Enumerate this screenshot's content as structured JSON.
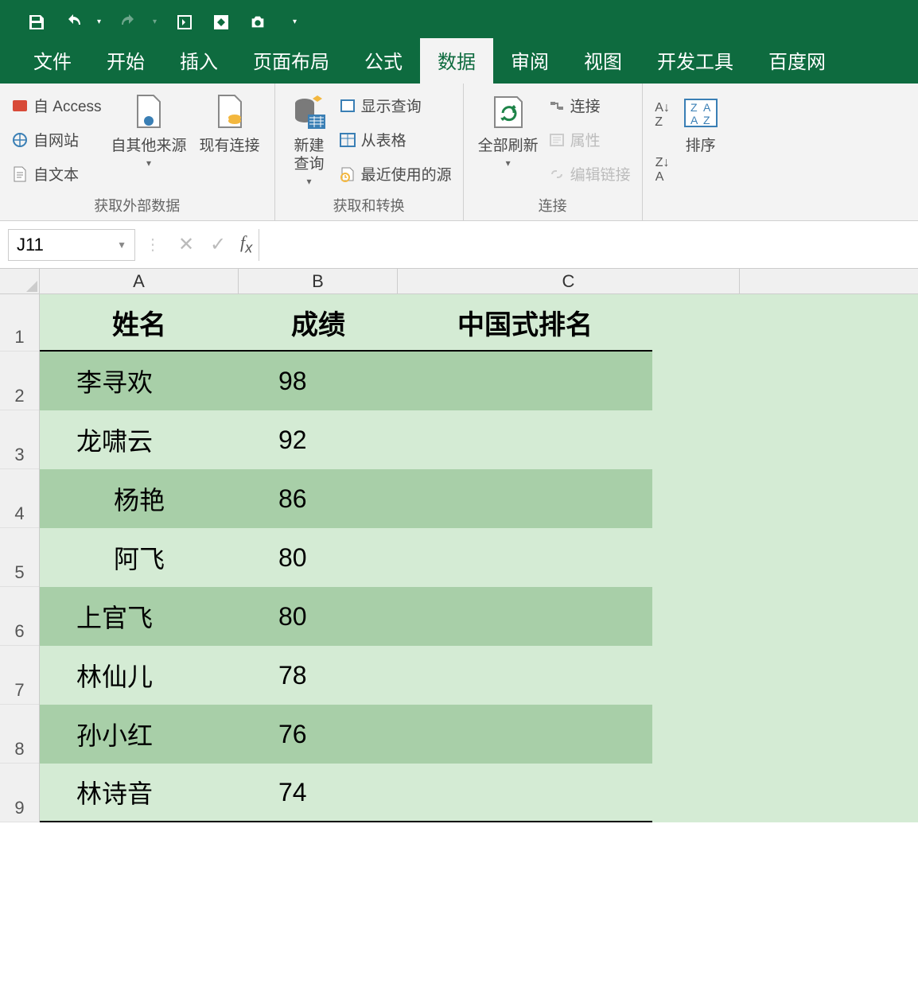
{
  "qat": {
    "items": [
      "save-icon",
      "undo-icon",
      "redo-icon",
      "touch-mode-icon",
      "addin-icon",
      "camera-icon"
    ]
  },
  "tabs": {
    "items": [
      "文件",
      "开始",
      "插入",
      "页面布局",
      "公式",
      "数据",
      "审阅",
      "视图",
      "开发工具",
      "百度网"
    ],
    "active_index": 5
  },
  "ribbon": {
    "group1": {
      "label": "获取外部数据",
      "access": "自 Access",
      "web": "自网站",
      "text": "自文本",
      "other": "自其他来源",
      "existing": "现有连接"
    },
    "group2": {
      "label": "获取和转换",
      "newquery": "新建\n查询",
      "showq": "显示查询",
      "fromtable": "从表格",
      "recent": "最近使用的源"
    },
    "group3": {
      "label": "连接",
      "refresh": "全部刷新",
      "conn": "连接",
      "prop": "属性",
      "editlink": "编辑链接"
    },
    "group4": {
      "sort": "排序"
    }
  },
  "formula_bar": {
    "name_box": "J11",
    "formula": ""
  },
  "columns": [
    "A",
    "B",
    "C"
  ],
  "row_numbers": [
    "1",
    "2",
    "3",
    "4",
    "5",
    "6",
    "7",
    "8",
    "9"
  ],
  "table": {
    "headers": [
      "姓名",
      "成绩",
      "中国式排名"
    ],
    "rows": [
      {
        "name": "李寻欢",
        "score": "98",
        "rank": ""
      },
      {
        "name": "龙啸云",
        "score": "92",
        "rank": ""
      },
      {
        "name": "杨艳",
        "score": "86",
        "rank": ""
      },
      {
        "name": "阿飞",
        "score": "80",
        "rank": ""
      },
      {
        "name": "上官飞",
        "score": "80",
        "rank": ""
      },
      {
        "name": "林仙儿",
        "score": "78",
        "rank": ""
      },
      {
        "name": "孙小红",
        "score": "76",
        "rank": ""
      },
      {
        "name": "林诗音",
        "score": "74",
        "rank": ""
      }
    ]
  }
}
